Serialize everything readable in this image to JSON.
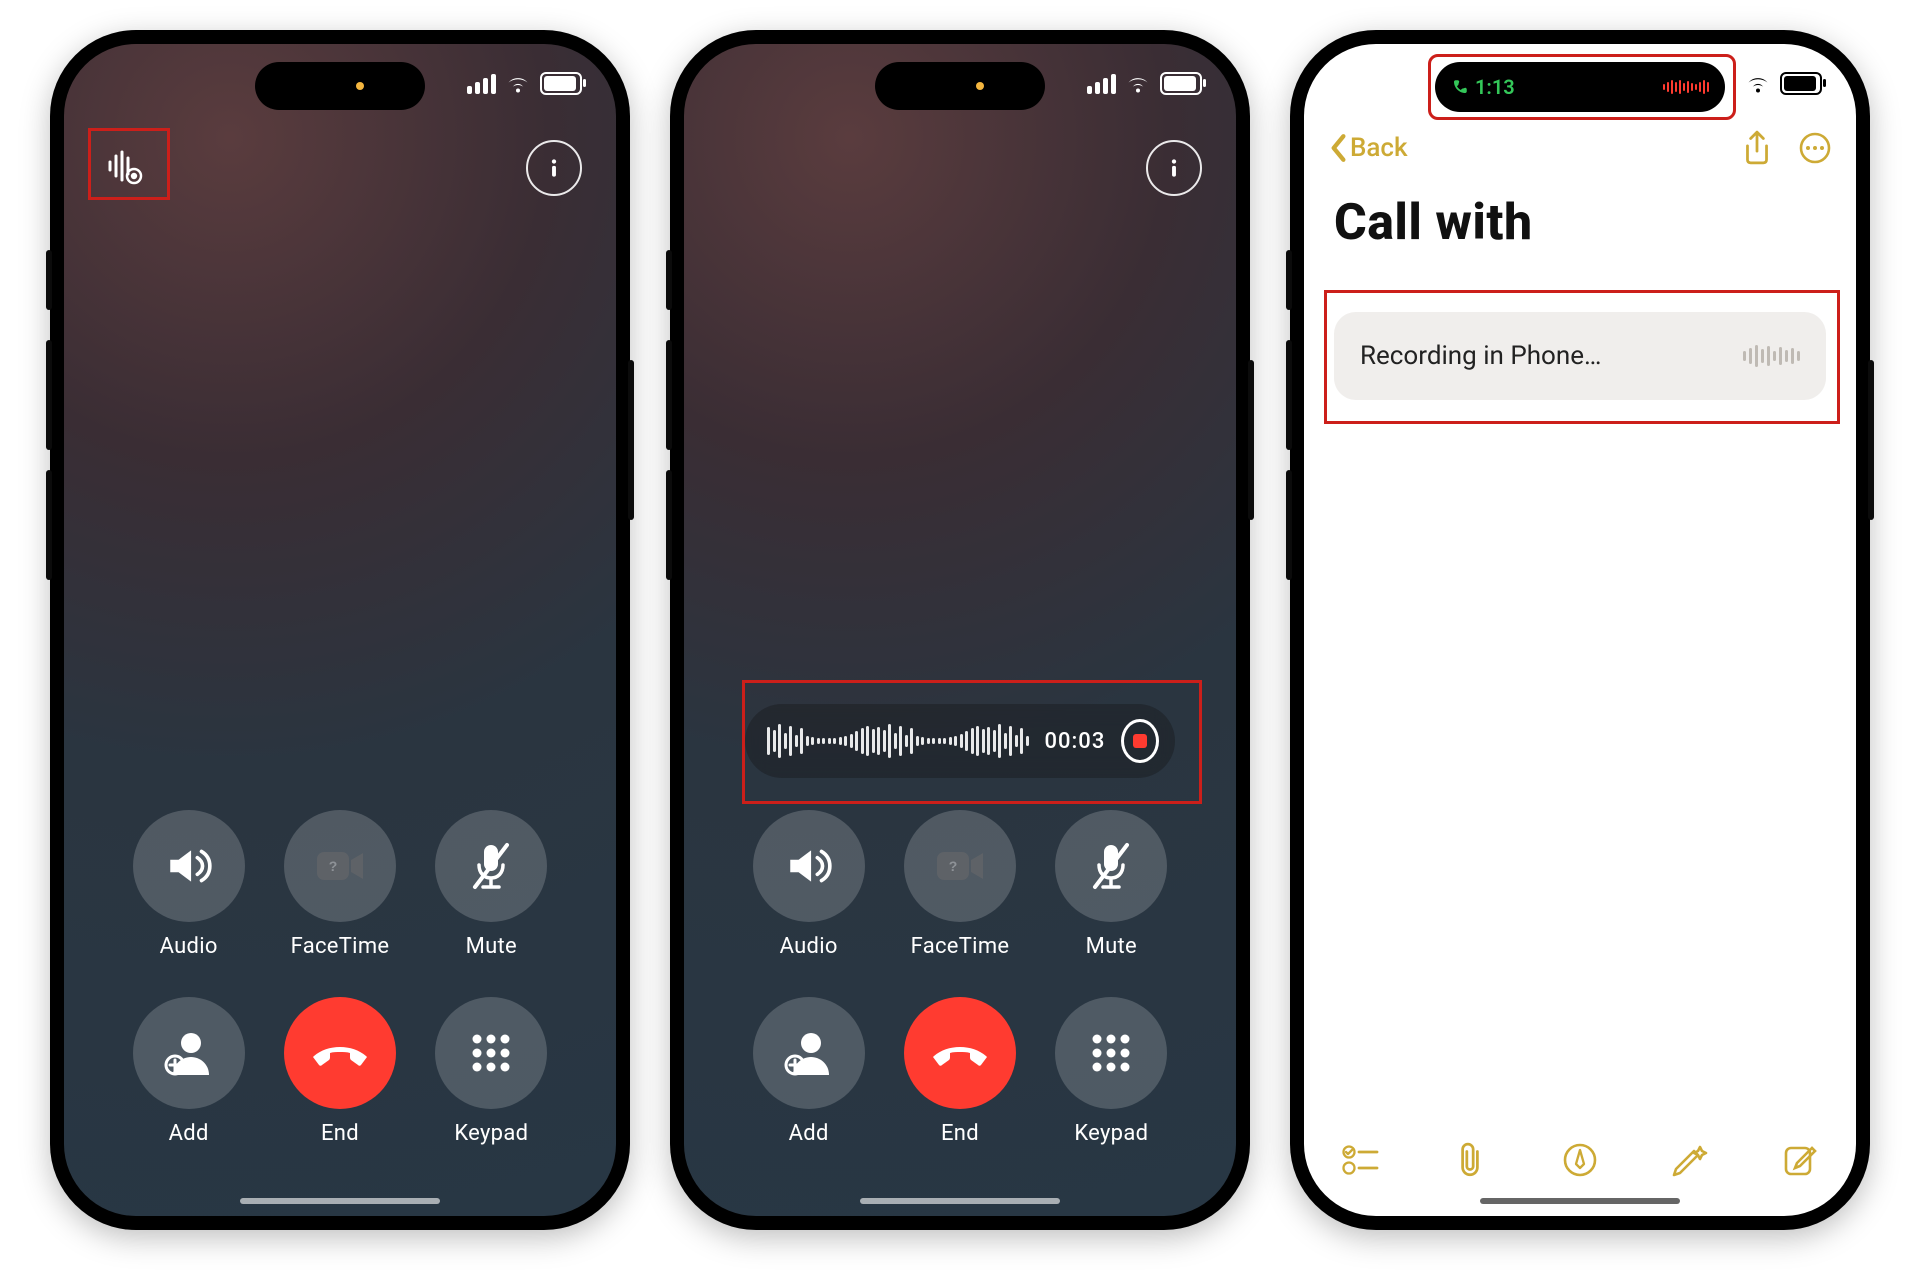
{
  "status": {
    "notes_time": "1:13"
  },
  "call": {
    "controls": {
      "audio": "Audio",
      "facetime": "FaceTime",
      "mute": "Mute",
      "add": "Add",
      "end": "End",
      "keypad": "Keypad"
    },
    "recording": {
      "elapsed": "00:03"
    }
  },
  "notes": {
    "nav": {
      "back": "Back"
    },
    "title": "Call with",
    "card": {
      "label": "Recording in Phone…"
    }
  }
}
